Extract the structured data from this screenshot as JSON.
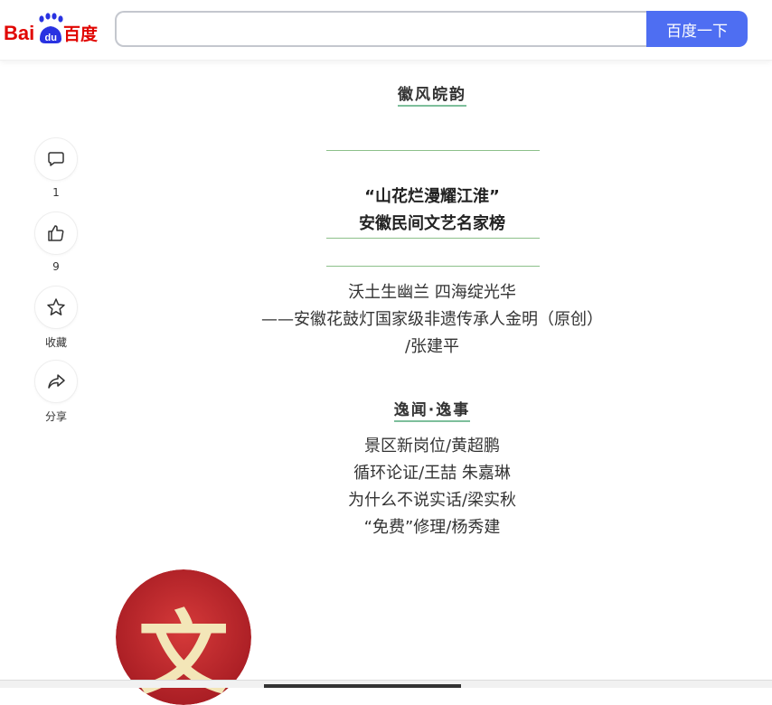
{
  "header": {
    "logo_text": "Bai百度",
    "search_placeholder": "",
    "search_value": "",
    "search_button_label": "百度一下"
  },
  "sidebar": {
    "comment_count": "1",
    "like_count": "9",
    "favorite_label": "收藏",
    "share_label": "分享"
  },
  "article": {
    "section1_title": "徽风皖韵",
    "feature_title_line1": "“山花烂漫耀江淮”",
    "feature_title_line2": "安徽民间文艺名家榜",
    "item1_line1": "沃土生幽兰  四海绽光华",
    "item1_line2": "——安徽花鼓灯国家级非遗传承人金明（原创）",
    "item1_line3": "/张建平",
    "section2_title": "逸闻·逸事",
    "list": [
      "景区新岗位/黄超鹏",
      "循环论证/王喆  朱嘉琳",
      "为什么不说实话/梁实秋",
      "“免费”修理/杨秀建"
    ],
    "emblem_char": "文"
  },
  "colors": {
    "brand_blue": "#4e6ef2",
    "logo_red": "#e10602",
    "logo_blue": "#2932e1",
    "accent_green": "#7dbf9b",
    "emblem_red": "#c8232c"
  }
}
